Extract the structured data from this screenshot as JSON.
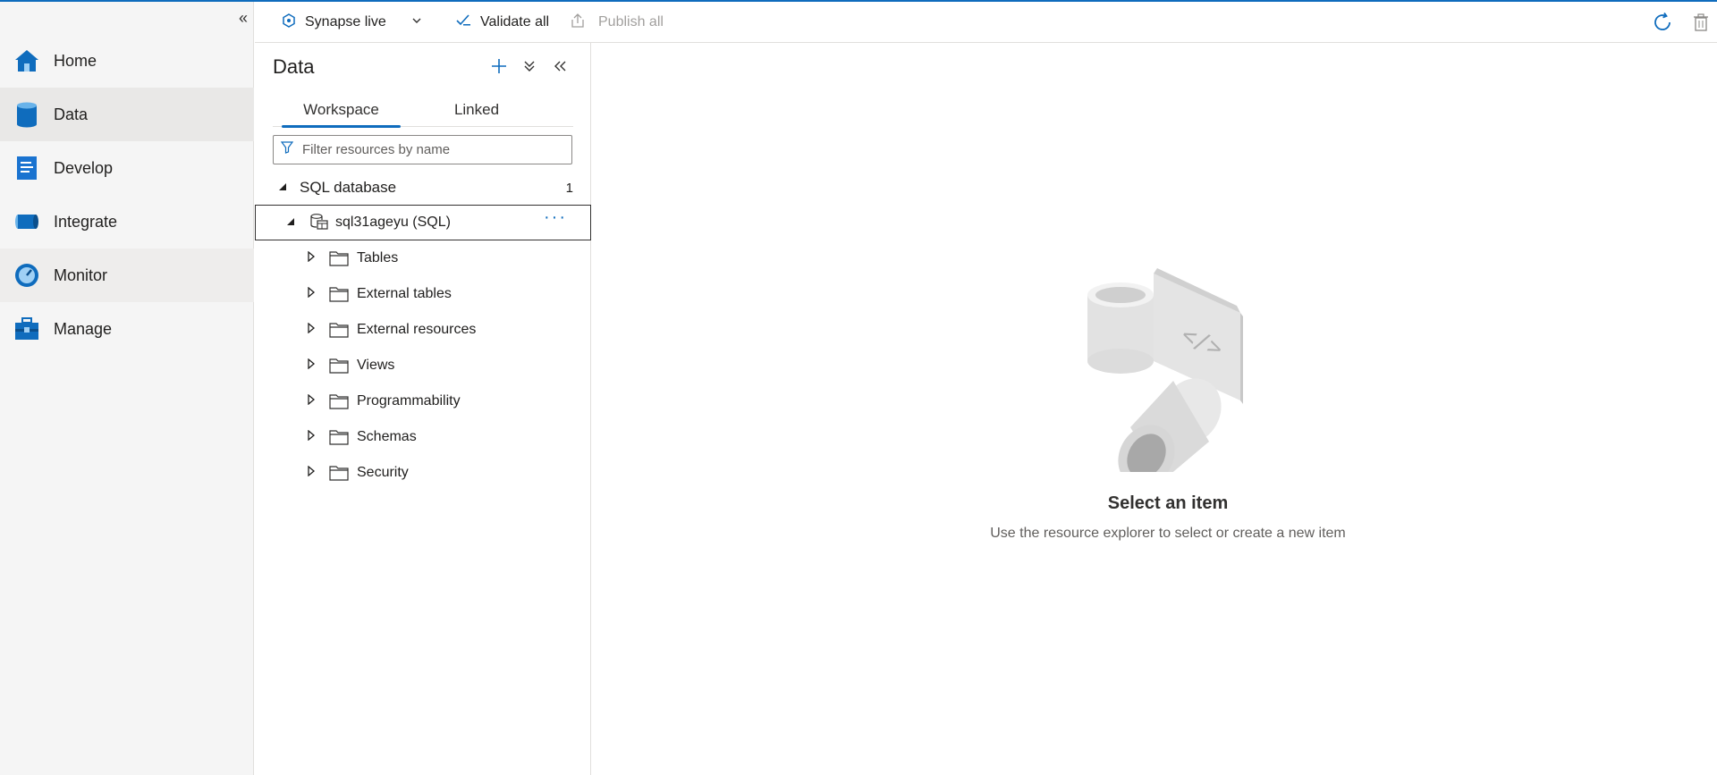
{
  "toolbar": {
    "mode_label": "Synapse live",
    "validate_label": "Validate all",
    "publish_label": "Publish all"
  },
  "nav": {
    "items": [
      {
        "label": "Home",
        "icon": "home-icon"
      },
      {
        "label": "Data",
        "icon": "data-cylinder-icon"
      },
      {
        "label": "Develop",
        "icon": "develop-document-icon"
      },
      {
        "label": "Integrate",
        "icon": "integrate-pipeline-icon"
      },
      {
        "label": "Monitor",
        "icon": "monitor-gauge-icon"
      },
      {
        "label": "Manage",
        "icon": "manage-toolbox-icon"
      }
    ],
    "active": "Data"
  },
  "data_panel": {
    "title": "Data",
    "tabs": [
      {
        "label": "Workspace",
        "active": true
      },
      {
        "label": "Linked",
        "active": false
      }
    ],
    "filter_placeholder": "Filter resources by name",
    "section": {
      "label": "SQL database",
      "count": "1"
    },
    "database": {
      "label": "sql31ageyu (SQL)",
      "more": "···"
    },
    "folders": [
      "Tables",
      "External tables",
      "External resources",
      "Views",
      "Programmability",
      "Schemas",
      "Security"
    ]
  },
  "empty_state": {
    "title": "Select an item",
    "subtitle": "Use the resource explorer to select or create a new item"
  },
  "colors": {
    "accent": "#0f6cbd",
    "nav_bg": "#f5f5f5",
    "active_nav_bg": "#e9e8e7"
  }
}
